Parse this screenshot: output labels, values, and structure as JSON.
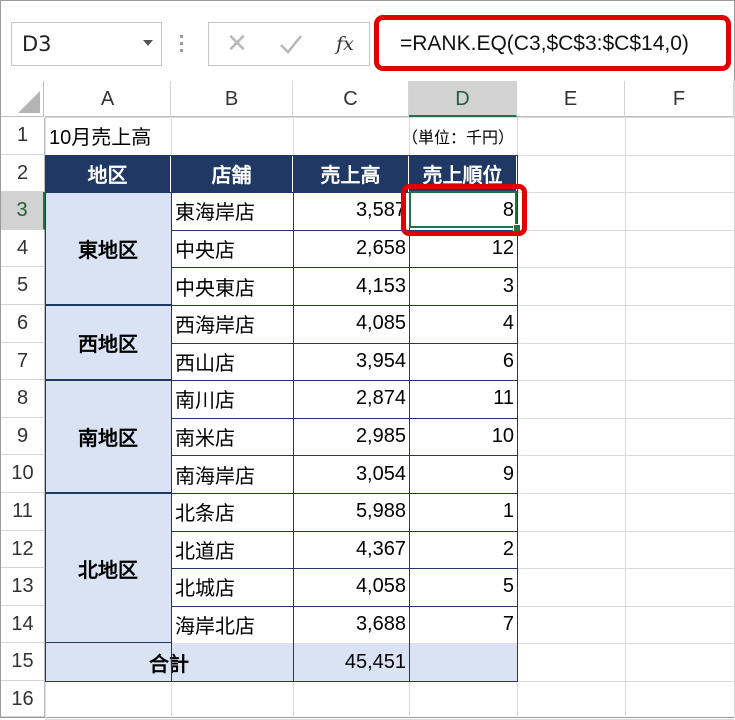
{
  "name_box": "D3",
  "formula_buttons": {
    "cancel": "✕",
    "enter": "✓",
    "function": "fx"
  },
  "formula": "=RANK.EQ(C3,$C$3:$C$14,0)",
  "columns": [
    "A",
    "B",
    "C",
    "D",
    "E",
    "F"
  ],
  "rows": [
    "1",
    "2",
    "3",
    "4",
    "5",
    "6",
    "7",
    "8",
    "9",
    "10",
    "11",
    "12",
    "13",
    "14",
    "15",
    "16"
  ],
  "sheet": {
    "title": "10月売上高",
    "unit": "（単位：千円）",
    "headers": {
      "region": "地区",
      "store": "店舗",
      "sales": "売上高",
      "rank": "売上順位"
    },
    "regions": [
      "東地区",
      "西地区",
      "南地区",
      "北地区"
    ],
    "records": [
      {
        "store": "東海岸店",
        "sales": "3,587",
        "rank": "8"
      },
      {
        "store": "中央店",
        "sales": "2,658",
        "rank": "12"
      },
      {
        "store": "中央東店",
        "sales": "4,153",
        "rank": "3"
      },
      {
        "store": "西海岸店",
        "sales": "4,085",
        "rank": "4"
      },
      {
        "store": "西山店",
        "sales": "3,954",
        "rank": "6"
      },
      {
        "store": "南川店",
        "sales": "2,874",
        "rank": "11"
      },
      {
        "store": "南米店",
        "sales": "2,985",
        "rank": "10"
      },
      {
        "store": "南海岸店",
        "sales": "3,054",
        "rank": "9"
      },
      {
        "store": "北条店",
        "sales": "5,988",
        "rank": "1"
      },
      {
        "store": "北道店",
        "sales": "4,367",
        "rank": "2"
      },
      {
        "store": "北城店",
        "sales": "4,058",
        "rank": "5"
      },
      {
        "store": "海岸北店",
        "sales": "3,688",
        "rank": "7"
      }
    ],
    "total_label": "合計",
    "total_value": "45,451"
  },
  "colors": {
    "header_bg": "#1f3864",
    "region_bg": "#dae3f3",
    "highlight": "#e00000",
    "selection": "#217346"
  }
}
